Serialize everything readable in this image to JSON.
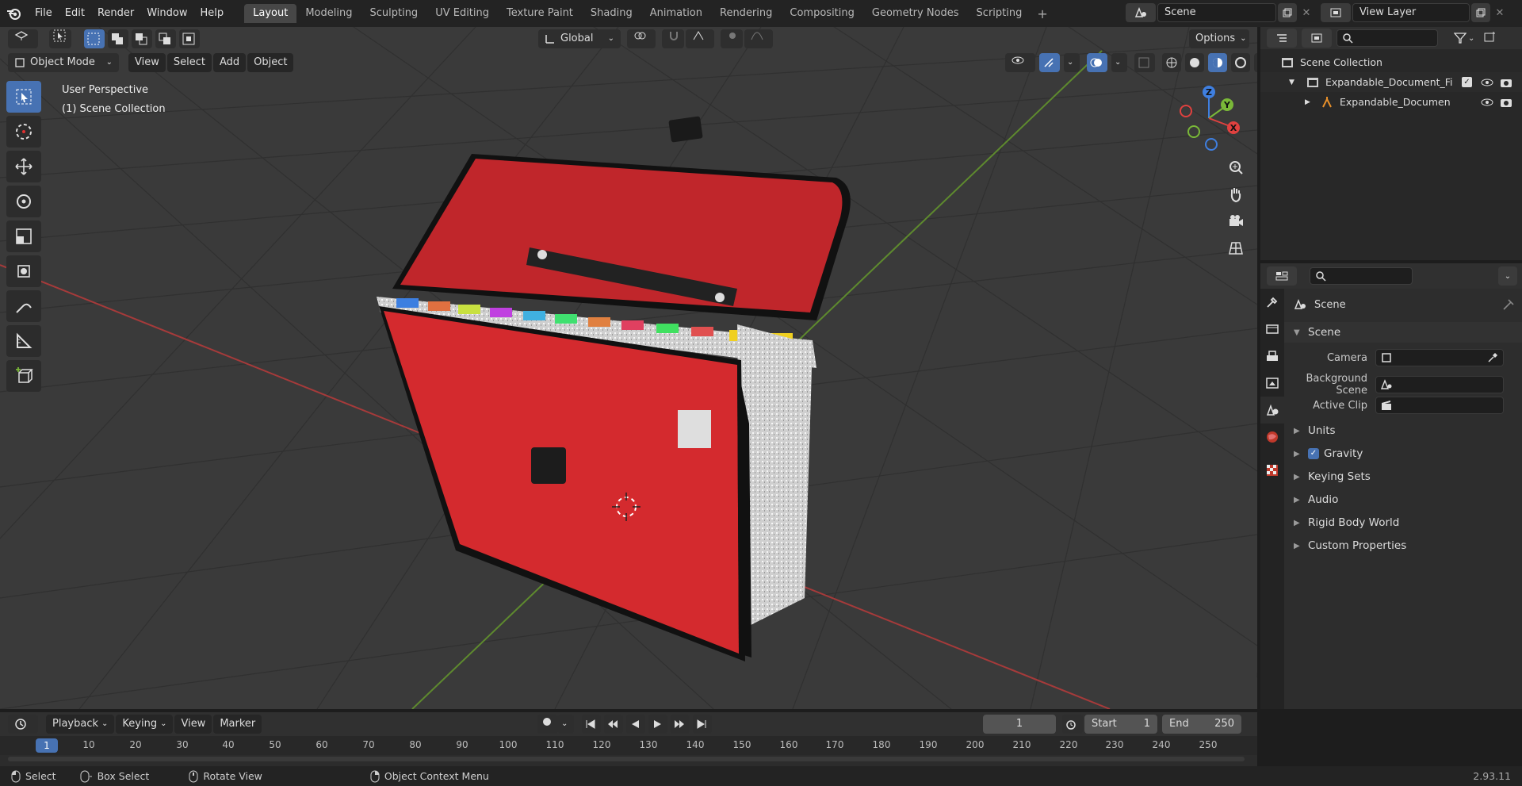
{
  "menu": [
    "File",
    "Edit",
    "Render",
    "Window",
    "Help"
  ],
  "workspaces": [
    "Layout",
    "Modeling",
    "Sculpting",
    "UV Editing",
    "Texture Paint",
    "Shading",
    "Animation",
    "Rendering",
    "Compositing",
    "Geometry Nodes",
    "Scripting"
  ],
  "active_workspace": "Layout",
  "scene_name": "Scene",
  "view_layer": "View Layer",
  "viewport": {
    "transform_orientation": "Global",
    "options_label": "Options",
    "mode": "Object Mode",
    "header_menus": [
      "View",
      "Select",
      "Add",
      "Object"
    ],
    "overlay_line1": "User Perspective",
    "overlay_line2": "(1) Scene Collection",
    "gizmo_axes": {
      "x": "X",
      "y": "Y",
      "z": "Z"
    }
  },
  "outliner": {
    "root": "Scene Collection",
    "collection": "Expandable_Document_File_F",
    "object": "Expandable_Document_F"
  },
  "properties": {
    "context": "Scene",
    "panel_title": "Scene",
    "camera_label": "Camera",
    "background_label": "Background Scene",
    "clip_label": "Active Clip",
    "panels": [
      "Units",
      "Gravity",
      "Keying Sets",
      "Audio",
      "Rigid Body World",
      "Custom Properties"
    ]
  },
  "timeline": {
    "menus": [
      "Playback",
      "Keying",
      "View",
      "Marker"
    ],
    "current_frame": "1",
    "start_label": "Start",
    "start_value": "1",
    "end_label": "End",
    "end_value": "250",
    "ruler": [
      "1",
      "10",
      "20",
      "30",
      "40",
      "50",
      "60",
      "70",
      "80",
      "90",
      "100",
      "110",
      "120",
      "130",
      "140",
      "150",
      "160",
      "170",
      "180",
      "190",
      "200",
      "210",
      "220",
      "230",
      "240",
      "250"
    ]
  },
  "status": {
    "select": "Select",
    "box_select": "Box Select",
    "rotate": "Rotate View",
    "context_menu": "Object Context Menu",
    "version": "2.93.11"
  },
  "colors": {
    "accent": "#4772b3",
    "bag_red": "#d42a2e",
    "x_axis": "#e0413f",
    "y_axis": "#7ab838",
    "z_axis": "#3f7fe0"
  }
}
